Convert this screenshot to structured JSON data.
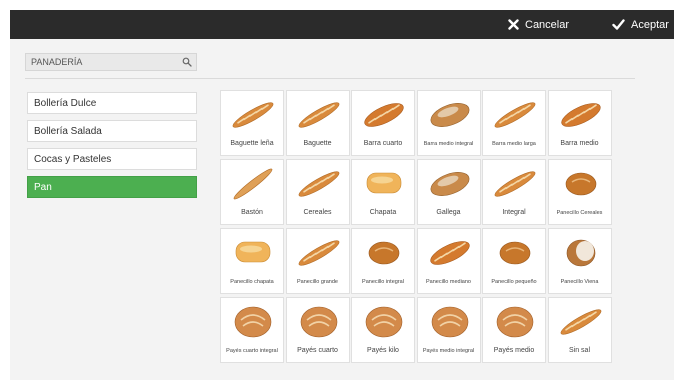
{
  "toolbar": {
    "cancel_label": "Cancelar",
    "accept_label": "Aceptar"
  },
  "search": {
    "value": "PANADERÍA"
  },
  "categories": [
    {
      "label": "Bollería Dulce"
    },
    {
      "label": "Bollería Salada"
    },
    {
      "label": "Cocas y Pasteles"
    },
    {
      "label": "Pan"
    }
  ],
  "products": [
    {
      "label": "Baguette leña",
      "shape": "baguette"
    },
    {
      "label": "Baguette",
      "shape": "baguette"
    },
    {
      "label": "Barra cuarto",
      "shape": "barra"
    },
    {
      "label": "Barra medio integral",
      "shape": "rustic"
    },
    {
      "label": "Barra medio larga",
      "shape": "baguette"
    },
    {
      "label": "Barra medio",
      "shape": "barra"
    },
    {
      "label": "Bastón",
      "shape": "baton"
    },
    {
      "label": "Cereales",
      "shape": "baguette"
    },
    {
      "label": "Chapata",
      "shape": "chapata"
    },
    {
      "label": "Gallega",
      "shape": "rustic"
    },
    {
      "label": "Integral",
      "shape": "baguette"
    },
    {
      "label": "Panecillo Cereales",
      "shape": "roll"
    },
    {
      "label": "Panecillo chapata",
      "shape": "chapata"
    },
    {
      "label": "Panecillo grande",
      "shape": "baguette"
    },
    {
      "label": "Panecillo integral",
      "shape": "roll"
    },
    {
      "label": "Panecillo mediano",
      "shape": "barra"
    },
    {
      "label": "Panecillo pequeño",
      "shape": "roll"
    },
    {
      "label": "Panecillo Viena",
      "shape": "viena"
    },
    {
      "label": "Payés cuarto integral",
      "shape": "round"
    },
    {
      "label": "Payés cuarto",
      "shape": "round"
    },
    {
      "label": "Payés kilo",
      "shape": "round"
    },
    {
      "label": "Payés medio integral",
      "shape": "round"
    },
    {
      "label": "Payés medio",
      "shape": "round"
    },
    {
      "label": "Sin sal",
      "shape": "baguette"
    }
  ],
  "colors": {
    "accent": "#4caf50",
    "topbar": "#2b2b2b",
    "crust": "#d98a3c"
  }
}
